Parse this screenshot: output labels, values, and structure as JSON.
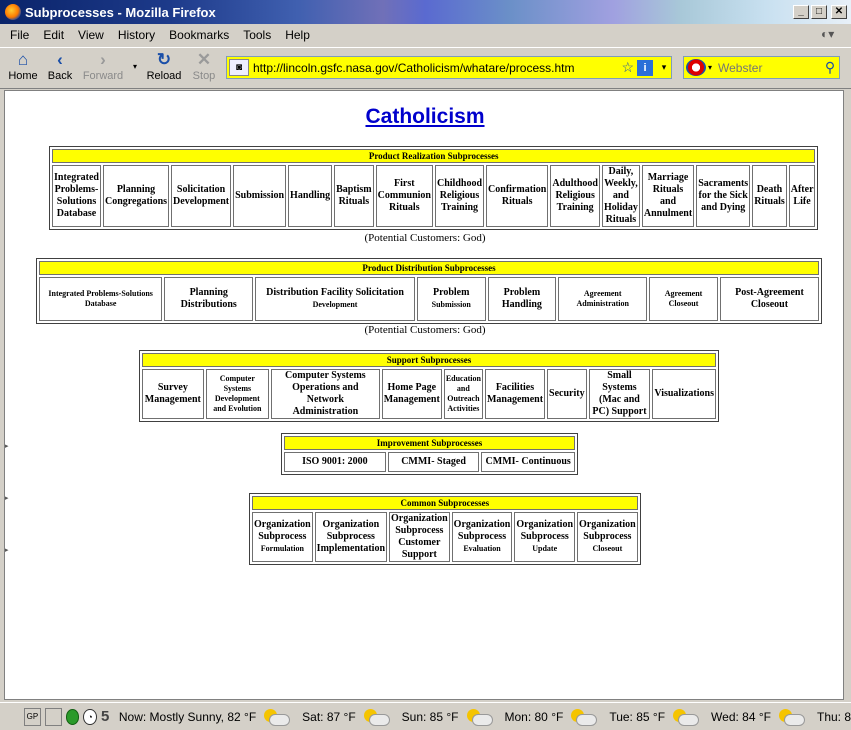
{
  "window": {
    "title": "Subprocesses - Mozilla Firefox",
    "controls": [
      "_",
      "□",
      "✕"
    ]
  },
  "menu": [
    "File",
    "Edit",
    "View",
    "History",
    "Bookmarks",
    "Tools",
    "Help"
  ],
  "nav": {
    "home": "Home",
    "back": "Back",
    "forward": "Forward",
    "reload": "Reload",
    "stop": "Stop",
    "url": "http://lincoln.gsfc.nasa.gov/Catholicism/whatare/process.htm",
    "search_placeholder": "Webster",
    "urlbar_color": "#ffff00"
  },
  "page": {
    "title": "Catholicism",
    "note": "(Potential Customers: God)",
    "header_color": "#ffff00",
    "tables": {
      "realization": {
        "header": "Product Realization Subprocesses",
        "cells": [
          "Integrated Problems-Solutions Database",
          "Planning Congregations",
          "Solicitation Development",
          "Submission",
          "Handling",
          "Baptism Rituals",
          "First Communion Rituals",
          "Childhood Religious Training",
          "Confirmation Rituals",
          "Adulthood Religious Training",
          "Daily, Weekly, and Holiday Rituals",
          "Marriage Rituals and Annulment",
          "Sacraments for the Sick and Dying",
          "Death Rituals",
          "After Life"
        ]
      },
      "distribution": {
        "header": "Product Distribution Subprocesses",
        "cells": [
          "Integrated Problems-Solutions Database",
          "Planning Distributions",
          "Distribution Facility Solicitation",
          "Development",
          "Problem",
          "Submission",
          "Problem Handling",
          "Agreement Administration",
          "Agreement Closeout",
          "Post-Agreement Closeout"
        ]
      },
      "support": {
        "header": "Support Subprocesses",
        "cells": [
          "Survey Management",
          "Computer Systems Development and Evolution",
          "Computer Systems Operations and Network Administration",
          "Home Page Management",
          "Education and Outreach Activities",
          "Facilities Management",
          "Security",
          "Small Systems (Mac and PC) Support",
          "Visualizations"
        ]
      },
      "improvement": {
        "header": "Improvement Subprocesses",
        "cells": [
          "ISO 9001: 2000",
          "CMMI- Staged",
          "CMMI- Continuous"
        ]
      },
      "common": {
        "header": "Common Subprocesses",
        "cells": [
          "Organization Subprocess",
          "Formulation",
          "Organization Subprocess Implementation",
          "Organization Subprocess Customer Support",
          "Organization Subprocess",
          "Evaluation",
          "Organization Subprocess",
          "Update",
          "Organization Subprocess",
          "Closeout"
        ]
      }
    }
  },
  "status": {
    "five": "5",
    "weather": [
      "Now: Mostly Sunny, 82 °F",
      "Sat: 87 °F",
      "Sun: 85 °F",
      "Mon: 80 °F",
      "Tue: 85 °F",
      "Wed: 84 °F",
      "Thu: 8"
    ]
  }
}
